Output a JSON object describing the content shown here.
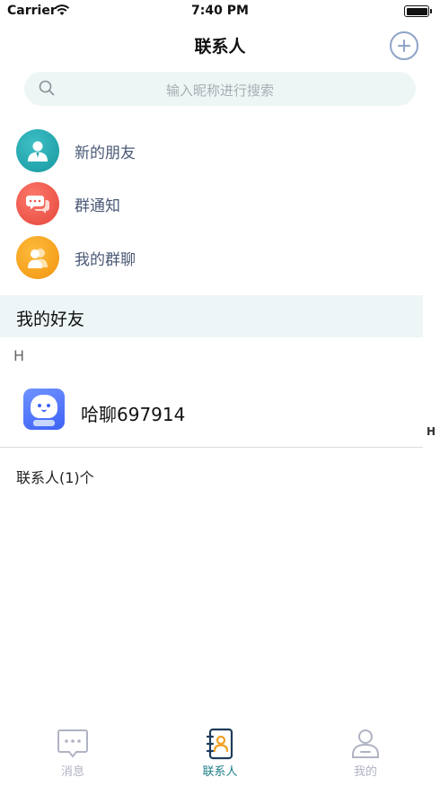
{
  "status_bar": {
    "carrier": "Carrier",
    "time": "7:40 PM"
  },
  "nav": {
    "title": "联系人"
  },
  "search": {
    "placeholder": "输入昵称进行搜索"
  },
  "entries": [
    {
      "label": "新的朋友",
      "icon": "person-icon",
      "color": "#1fa3aa"
    },
    {
      "label": "群通知",
      "icon": "chat-bubble-icon",
      "color": "#ef5a4c"
    },
    {
      "label": "我的群聊",
      "icon": "group-icon",
      "color": "#f6a323"
    }
  ],
  "section": {
    "title": "我的好友"
  },
  "index_letter": "H",
  "friends": [
    {
      "name": "哈聊697914"
    }
  ],
  "side_index": [
    "H"
  ],
  "contact_count": "联系人(1)个",
  "tabs": [
    {
      "label": "消息",
      "icon": "message-icon",
      "active": false
    },
    {
      "label": "联系人",
      "icon": "contacts-book-icon",
      "active": true
    },
    {
      "label": "我的",
      "icon": "profile-icon",
      "active": false
    }
  ],
  "colors": {
    "accent": "#1e7f89",
    "search_bg": "#eef5f5",
    "section_bg": "#eef5f7"
  }
}
